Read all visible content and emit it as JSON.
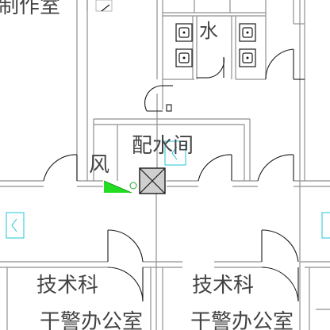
{
  "rooms": {
    "top_left": "制作室",
    "water": "水",
    "water_room": "配水间",
    "wind": "风",
    "office_left_line1": "技术科",
    "office_left_line2": "干警办公室",
    "office_right_line1": "技术科",
    "office_right_line2": "干警办公室"
  },
  "colors": {
    "walls": "#8f8f8f",
    "doors": "#1a1a1a",
    "fan_highlight": "#22dd22",
    "light_fixture": "#22c4d8",
    "text": "#444444"
  },
  "icons": {
    "sink": "sink-icon",
    "light": "ceiling-light-icon",
    "shaft": "duct-shaft-icon",
    "fan": "exhaust-fan-icon"
  }
}
